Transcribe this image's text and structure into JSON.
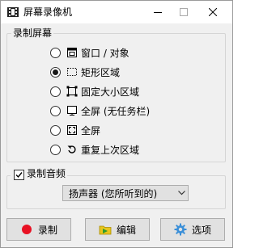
{
  "window": {
    "title": "屏幕录像机",
    "icon": "film-reel-icon",
    "controls": {
      "minimize": "minimize-icon",
      "maximize": "maximize-icon",
      "close": "close-icon"
    }
  },
  "record_screen": {
    "legend": "录制屏幕",
    "selected_index": 1,
    "options": [
      {
        "label": "窗口 / 对象",
        "icon": "window-icon"
      },
      {
        "label": "矩形区域",
        "icon": "dashed-rectangle-icon"
      },
      {
        "label": "固定大小区域",
        "icon": "fixed-frame-icon"
      },
      {
        "label": "全屏 (无任务栏)",
        "icon": "monitor-icon"
      },
      {
        "label": "全屏",
        "icon": "fullscreen-corners-icon"
      },
      {
        "label": "重复上次区域",
        "icon": "repeat-arrow-icon"
      }
    ]
  },
  "record_audio": {
    "legend": "录制音频",
    "checked": true,
    "source": "扬声器 (您所听到的)"
  },
  "buttons": {
    "record": {
      "label": "录制",
      "icon": "red-record-dot-icon",
      "color": "#e81123"
    },
    "edit": {
      "label": "编辑",
      "icon": "folder-play-icon"
    },
    "options": {
      "label": "选项",
      "icon": "gear-icon"
    }
  }
}
